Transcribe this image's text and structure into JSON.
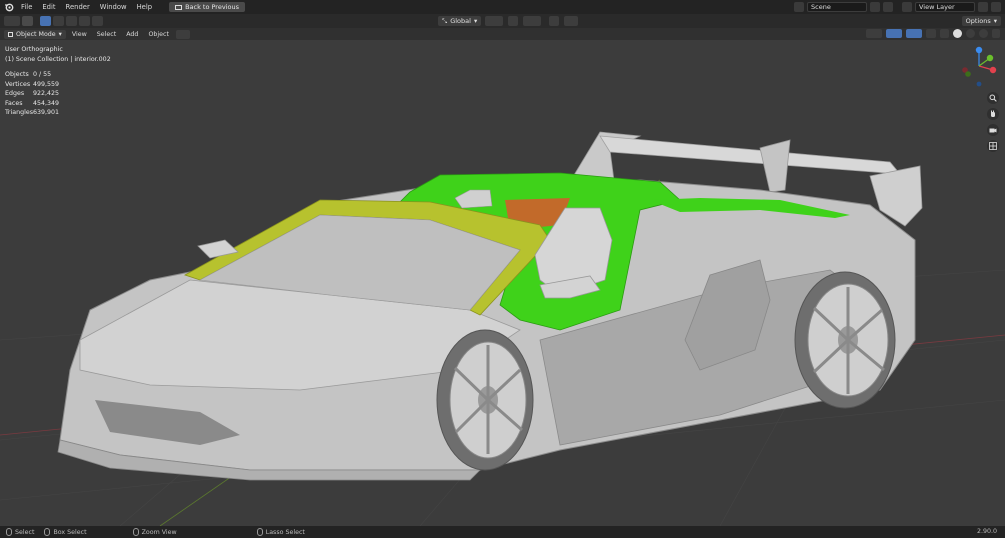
{
  "menu": {
    "items": [
      "File",
      "Edit",
      "Render",
      "Window",
      "Help"
    ],
    "back_label": "Back to Previous"
  },
  "top_right": {
    "scene": "Scene",
    "view_layer": "View Layer"
  },
  "viewport_header": {
    "orientation": "Global",
    "options_label": "Options"
  },
  "tool_header": {
    "mode": "Object Mode",
    "view": "View",
    "select": "Select",
    "add": "Add",
    "object": "Object"
  },
  "viewport": {
    "projection": "User Orthographic",
    "collection": "(1) Scene Collection | interior.002",
    "stats": [
      {
        "label": "Objects",
        "value": "0 / 55"
      },
      {
        "label": "Vertices",
        "value": "499,559"
      },
      {
        "label": "Edges",
        "value": "922,425"
      },
      {
        "label": "Faces",
        "value": "454,349"
      },
      {
        "label": "Triangles",
        "value": "639,901"
      }
    ]
  },
  "gizmo": {
    "axis_x": "X",
    "axis_y": "Y",
    "axis_z": "Z",
    "color_x": "#e2414d",
    "color_y": "#6bbf2c",
    "color_z": "#3a8cf0"
  },
  "statusbar": {
    "select": "Select",
    "box_select": "Box Select",
    "zoom": "Zoom View",
    "lasso": "Lasso Select",
    "version": "2.90.0"
  },
  "colors": {
    "accent": "#4772b3",
    "selected_green": "#3fd21a",
    "selected_yellow": "#b7c22e"
  }
}
